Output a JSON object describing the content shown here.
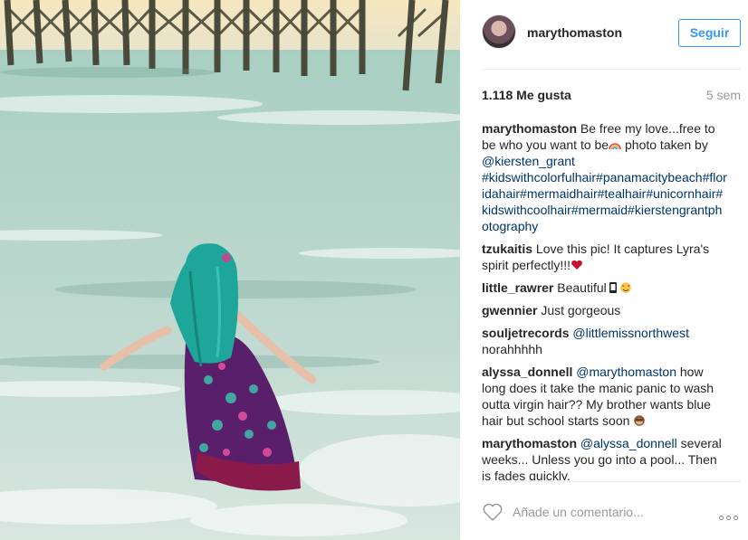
{
  "post": {
    "author": "marythomaston",
    "follow_label": "Seguir",
    "likes": "1.118 Me gusta",
    "age": "5 sem"
  },
  "caption": {
    "user": "marythomaston",
    "text1": "Be free my love...free to be who you want to be",
    "text2": " photo taken by ",
    "mention": "@kiersten_grant",
    "hashtags": " #kidswithcolorfulhair#panamacitybeach#floridahair#mermaidhair#tealhair#unicornhair#kidswithcoolhair#mermaid#kierstengrantphotography"
  },
  "comments": [
    {
      "user": "tzukaitis",
      "text": "Love this pic! It captures Lyra's spirit perfectly!!!"
    },
    {
      "user": "little_rawrer",
      "text": "Beautiful"
    },
    {
      "user": "gwennier",
      "text": "Just gorgeous"
    },
    {
      "user": "souljetrecords",
      "mention": "@littlemissnorthwest",
      "text": " norahhhhh"
    },
    {
      "user": "alyssa_donnell",
      "mention": "@marythomaston",
      "text": " how long does it take the manic panic to wash outta virgin hair?? My brother wants blue hair but school starts soon "
    },
    {
      "user": "marythomaston",
      "mention": "@alyssa_donnell",
      "text": " several weeks... Unless you go into a pool... Then is fades quickly."
    }
  ],
  "footer": {
    "comment_placeholder": "Añade un comentario...",
    "like_icon": "heart-icon",
    "more_icon": "ellipsis-icon"
  },
  "colors": {
    "link": "#003569",
    "follow": "#3897f0",
    "muted": "#999999"
  }
}
